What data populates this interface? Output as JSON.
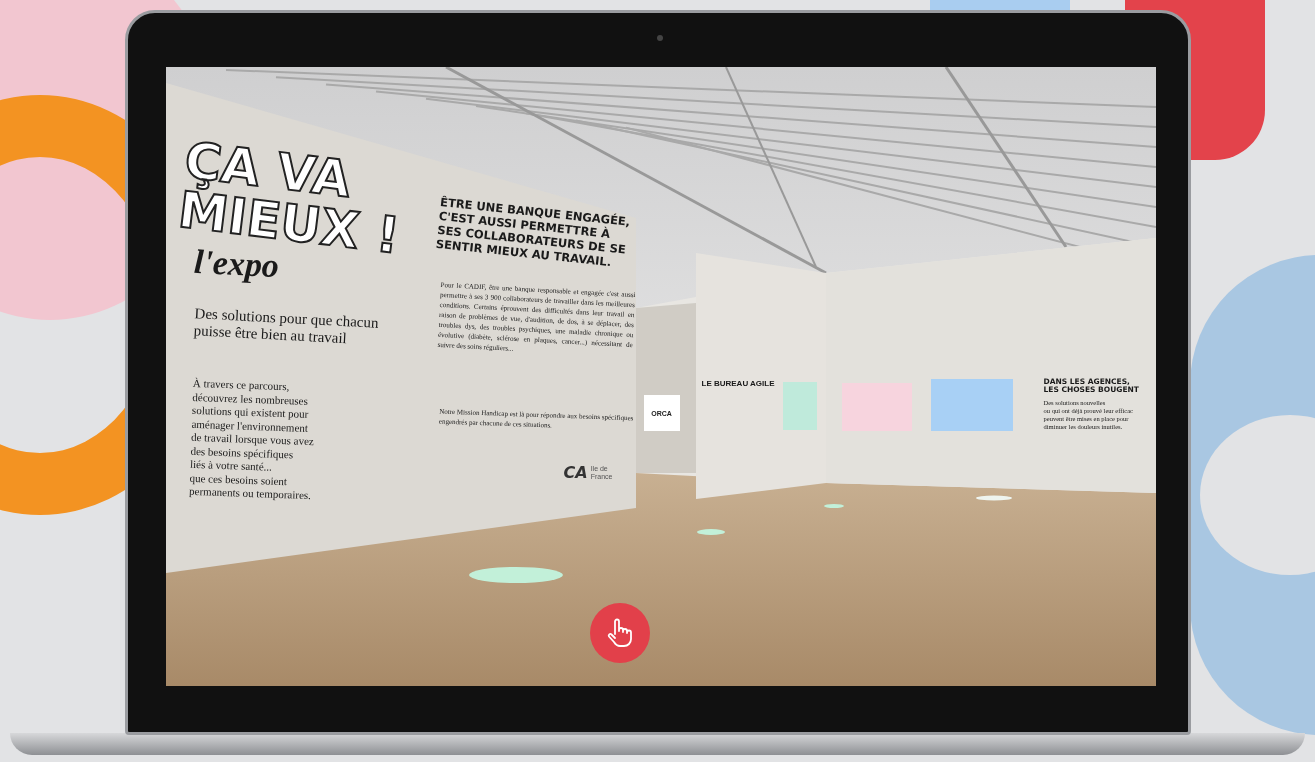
{
  "exhibition_view": {
    "title_lines": [
      "ÇA VA",
      "MIEUX !"
    ],
    "expo_label": "l'expo",
    "subtitle": "Des solutions pour que chacun\npuisse être bien au travail",
    "intro": "À travers ce parcours,\ndécouvrez les nombreuses\nsolutions qui existent pour\naménager l'environnement\nde travail lorsque vous avez\ndes besoins spécifiques\nliés à votre santé...\nque ces besoins soient\npermanents ou temporaires.",
    "heading": "ÊTRE UNE BANQUE ENGAGÉE, C'EST AUSSI PERMETTRE À SES COLLABORATEURS DE SE SENTIR MIEUX AU TRAVAIL.",
    "body": "Pour le CADIF, être une banque responsable et engagée c'est aussi permettre à ses 3 900 collaborateurs de travailler dans les meilleures conditions. Certains éprouvent des difficultés dans leur travail en raison de problèmes de vue, d'audition, de dos, à se déplacer, des troubles dys, des troubles psychiques, une maladie chronique ou évolutive (diabète, sclérose en plaques, cancer...) nécessitant de suivre des soins réguliers...",
    "mission": "Notre Mission Handicap est là pour répondre aux besoins spécifiques engendrés par chacune de ces situations.",
    "bank_logo": {
      "mark": "CA",
      "text": "Ile de France"
    },
    "panel_logo": "ORCA",
    "section_title": "LE BUREAU AGILE",
    "agencies_heading": "DANS LES AGENCES,\nLES CHOSES BOUGENT",
    "agencies_text": "Des solutions nouvelles\nou qui ont déjà prouvé leur efficac\npeuvent être mises en place pour\ndiminuer les douleurs inutiles."
  }
}
